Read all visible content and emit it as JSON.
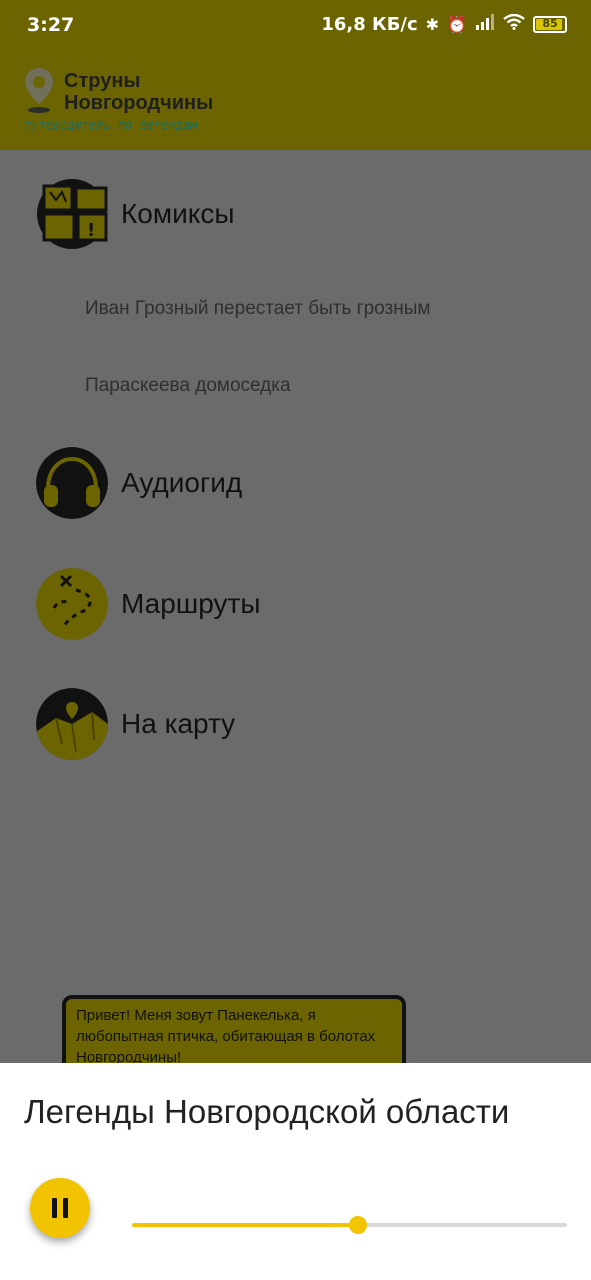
{
  "status_bar": {
    "time": "3:27",
    "network_speed": "16,8 КБ/с",
    "battery_level": "85",
    "icons": [
      "bluetooth-icon",
      "alarm-icon",
      "signal-icon",
      "wifi-icon",
      "battery-icon"
    ]
  },
  "header": {
    "logo_line1": "Струны",
    "logo_line2": "Новгородчины",
    "logo_subtitle": "путеводитель по легендам"
  },
  "menu": {
    "comics": {
      "label": "Комиксы",
      "icon": "comics-icon",
      "sub_items": [
        "Иван Грозный перестает быть грозным",
        "Параскеева домоседка"
      ]
    },
    "audioguide": {
      "label": "Аудиогид",
      "icon": "headphones-icon"
    },
    "routes": {
      "label": "Маршруты",
      "icon": "route-map-icon"
    },
    "map": {
      "label": "На карту",
      "icon": "map-pin-icon"
    }
  },
  "bubble": {
    "text": "Привет! Меня зовут Панекелька, я любопытная птичка, обитающая в болотах Новгородчины!"
  },
  "player": {
    "title": "Легенды Новгородской области",
    "state": "playing",
    "progress": 0.52
  },
  "colors": {
    "accent": "#f2c400",
    "header_dimmed": "#6b6400",
    "overlay": "#6b6b6b"
  }
}
